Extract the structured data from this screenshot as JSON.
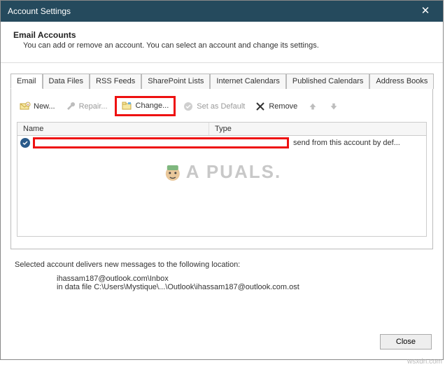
{
  "title": "Account Settings",
  "header": {
    "title": "Email Accounts",
    "subtitle": "You can add or remove an account. You can select an account and change its settings."
  },
  "tabs": [
    "Email",
    "Data Files",
    "RSS Feeds",
    "SharePoint Lists",
    "Internet Calendars",
    "Published Calendars",
    "Address Books"
  ],
  "toolbar": {
    "new": "New...",
    "repair": "Repair...",
    "change": "Change...",
    "default": "Set as Default",
    "remove": "Remove"
  },
  "columns": {
    "name": "Name",
    "type": "Type"
  },
  "row": {
    "type_text": "send from this account by def..."
  },
  "watermark": "A  PUALS.",
  "info": {
    "line": "Selected account delivers new messages to the following location:",
    "loc1": "ihassam187@outlook.com\\Inbox",
    "loc2": "in data file C:\\Users\\Mystique\\...\\Outlook\\ihassam187@outlook.com.ost"
  },
  "close": "Close",
  "site": "wsxdn.com"
}
